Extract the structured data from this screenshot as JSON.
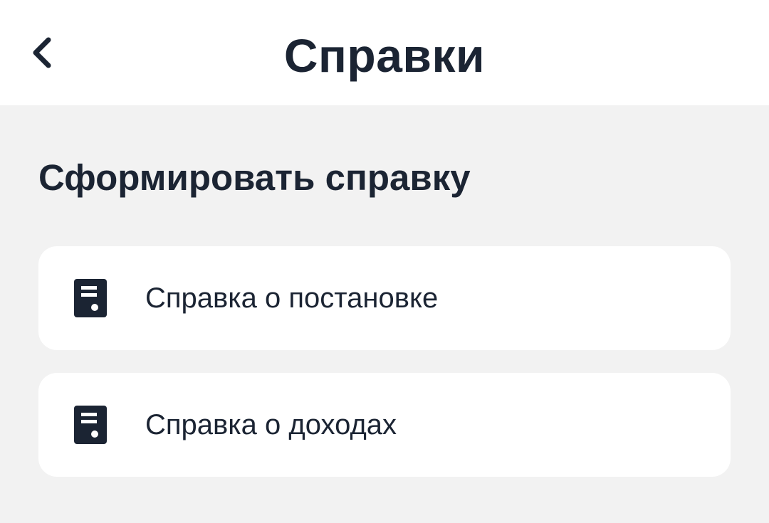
{
  "header": {
    "title": "Справки",
    "back_icon": "chevron-left-icon"
  },
  "section": {
    "title": "Сформировать справку"
  },
  "items": [
    {
      "label": "Справка о постановке",
      "icon": "document-icon"
    },
    {
      "label": "Справка о доходах",
      "icon": "document-icon"
    }
  ],
  "colors": {
    "text": "#1b2433",
    "header_bg": "#ffffff",
    "page_bg": "#f2f2f2",
    "card_bg": "#ffffff",
    "icon": "#1b2433"
  }
}
